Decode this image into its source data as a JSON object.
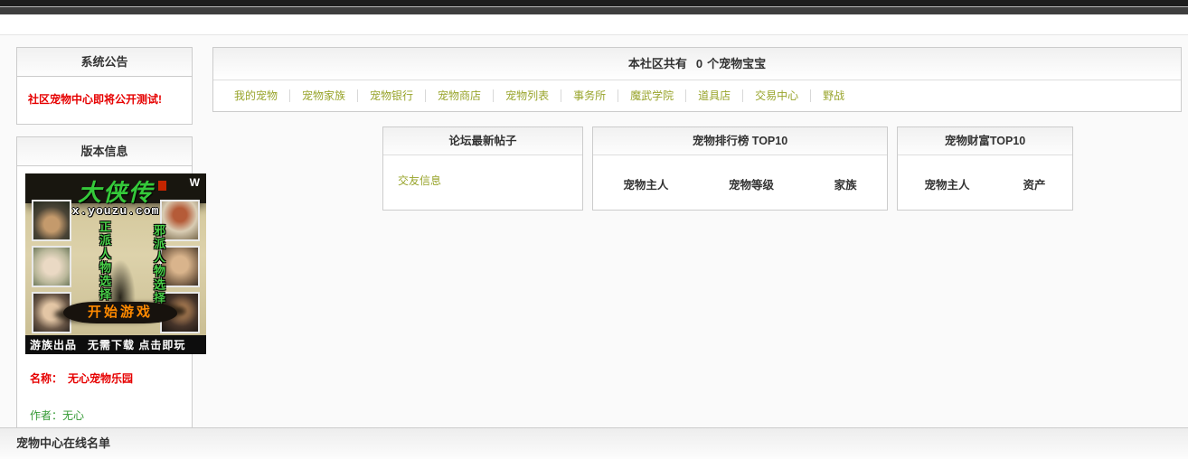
{
  "colors": {
    "announcement_red": "#e60000",
    "nav_link_olive": "#98a42b",
    "author_green": "#339933",
    "ad_title_green": "#35c93a",
    "ad_start_orange": "#ff8a00",
    "panel_border": "#cccccc"
  },
  "sidebar": {
    "announcement": {
      "title": "系统公告",
      "text": "社区宠物中心即将公开测试!"
    },
    "version": {
      "title": "版本信息",
      "name_label": "名称：",
      "name_value": "无心宠物乐园",
      "author_label": "作者：",
      "author_value": "无心",
      "ad": {
        "game_title": "大侠传",
        "site": "x.youzu.com",
        "left_label": "正派人物选择",
        "right_label": "邪派人物选择",
        "start_button": "开始游戏",
        "footer_left": "游族出品",
        "footer_right": "无需下载 点击即玩",
        "corner_mark": "W"
      }
    }
  },
  "main": {
    "stats": {
      "prefix": "本社区共有",
      "count": "0",
      "suffix": "个宠物宝宝"
    },
    "nav": [
      "我的宠物",
      "宠物家族",
      "宠物银行",
      "宠物商店",
      "宠物列表",
      "事务所",
      "魔武学院",
      "道具店",
      "交易中心",
      "野战"
    ],
    "panels": {
      "latest_posts": {
        "title": "论坛最新帖子",
        "link": "交友信息"
      },
      "pet_ranking": {
        "title": "宠物排行榜  TOP10",
        "columns": [
          "宠物主人",
          "宠物等级",
          "家族"
        ]
      },
      "pet_wealth": {
        "title": "宠物财富TOP10",
        "columns": [
          "宠物主人",
          "资产"
        ]
      }
    }
  },
  "footer": {
    "title": "宠物中心在线名单"
  }
}
